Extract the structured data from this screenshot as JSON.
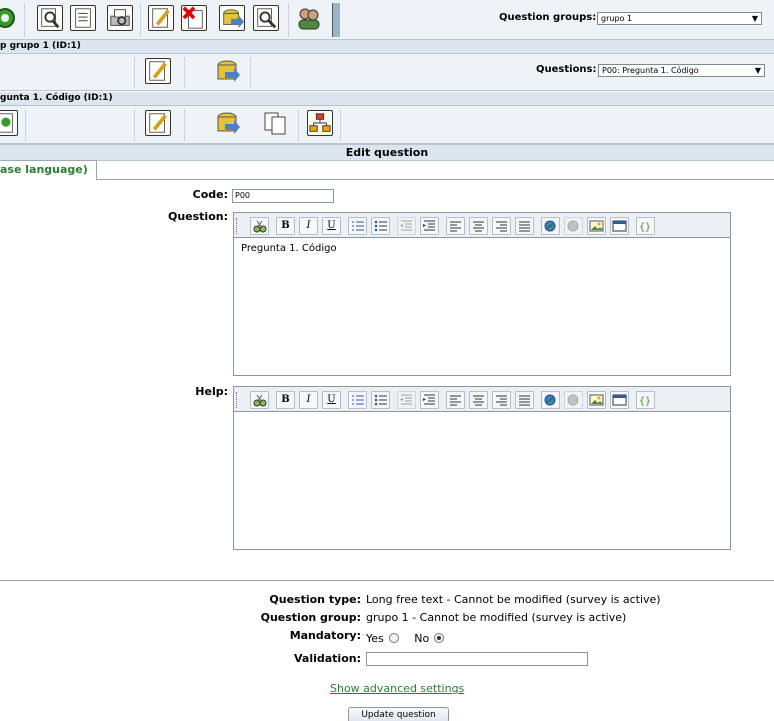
{
  "survey_toolbar": {
    "question_groups_label": "Question groups:",
    "question_groups_selected": "grupo 1"
  },
  "group_bar": {
    "title": "p grupo 1 (ID:1)",
    "questions_label": "Questions:",
    "questions_selected": "P00:  Pregunta 1. Código"
  },
  "question_bar": {
    "title": "gunta 1. Código (ID:1)"
  },
  "edit_header": "Edit question",
  "language_tab": "ase language)",
  "form": {
    "code_label": "Code:",
    "code_value": "P00",
    "question_label": "Question:",
    "question_text": "Pregunta 1. Código",
    "help_label": "Help:",
    "help_text": "",
    "question_type_label": "Question type:",
    "question_type_value": "Long free text - Cannot be modified (survey is active)",
    "question_group_label": "Question group:",
    "question_group_value": "grupo 1 - Cannot be modified (survey is active)",
    "mandatory_label": "Mandatory:",
    "mandatory_yes": "Yes",
    "mandatory_no": "No",
    "mandatory_selected": "No",
    "validation_label": "Validation:",
    "validation_value": "",
    "advanced_link": "Show advanced settings",
    "update_button": "Update question"
  },
  "editor_buttons": {
    "bold": "B",
    "italic": "I",
    "underline": "U"
  }
}
